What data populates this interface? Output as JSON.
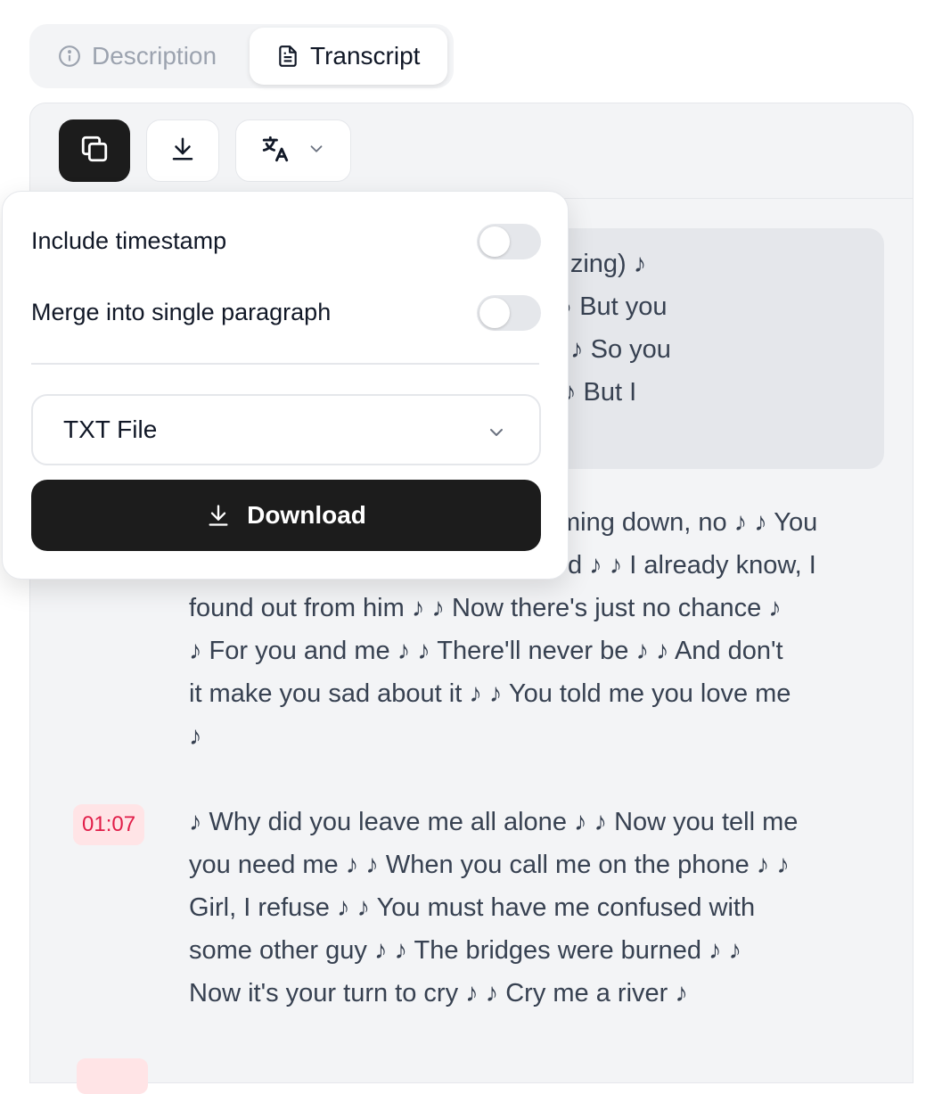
{
  "tabs": {
    "description": "Description",
    "transcript": "Transcript"
  },
  "popover": {
    "include_timestamp": "Include timestamp",
    "merge_paragraph": "Merge into single paragraph",
    "toggles": {
      "include_timestamp": false,
      "merge_paragraph": false
    },
    "format_select": "TXT File",
    "download_label": "Download"
  },
  "segments": [
    {
      "timestamp": "",
      "text_lines": [
        "(singer vocalizing) ♪",
        "my Earth ♪ ♪ But you",
        "ed you, no ♪ ♪ So you",
        "ther plans ♪ ♪ But I"
      ]
    },
    {
      "timestamp": "",
      "text_lines": [
        "ming down, no ♪ ♪ You",
        "d ♪ ♪ I already know, I",
        "found out from him ♪ ♪ Now there's just no chance ♪",
        "♪ For you and me ♪ ♪ There'll never be ♪ ♪ And don't",
        "it make you sad about it ♪ ♪ You told me you love me",
        "♪"
      ]
    },
    {
      "timestamp": "01:07",
      "text_lines": [
        "♪ Why did you leave me all alone ♪ ♪ Now you tell me",
        "you need me ♪ ♪ When you call me on the phone ♪ ♪",
        "Girl, I refuse ♪ ♪ You must have me confused with",
        "some other guy ♪ ♪ The bridges were burned ♪ ♪",
        "Now it's your turn to cry ♪ ♪ Cry me a river ♪"
      ]
    }
  ],
  "icons": {
    "description_tab": "info-icon",
    "transcript_tab": "document-icon",
    "copy": "copy-icon",
    "download": "download-icon",
    "translate": "translate-icon",
    "chevron": "chevron-down-icon"
  },
  "colors": {
    "dark_button": "#1c1c1c",
    "timestamp_bg": "#ffe4e6",
    "timestamp_text": "#e11d48",
    "panel_bg": "#f3f4f6"
  }
}
